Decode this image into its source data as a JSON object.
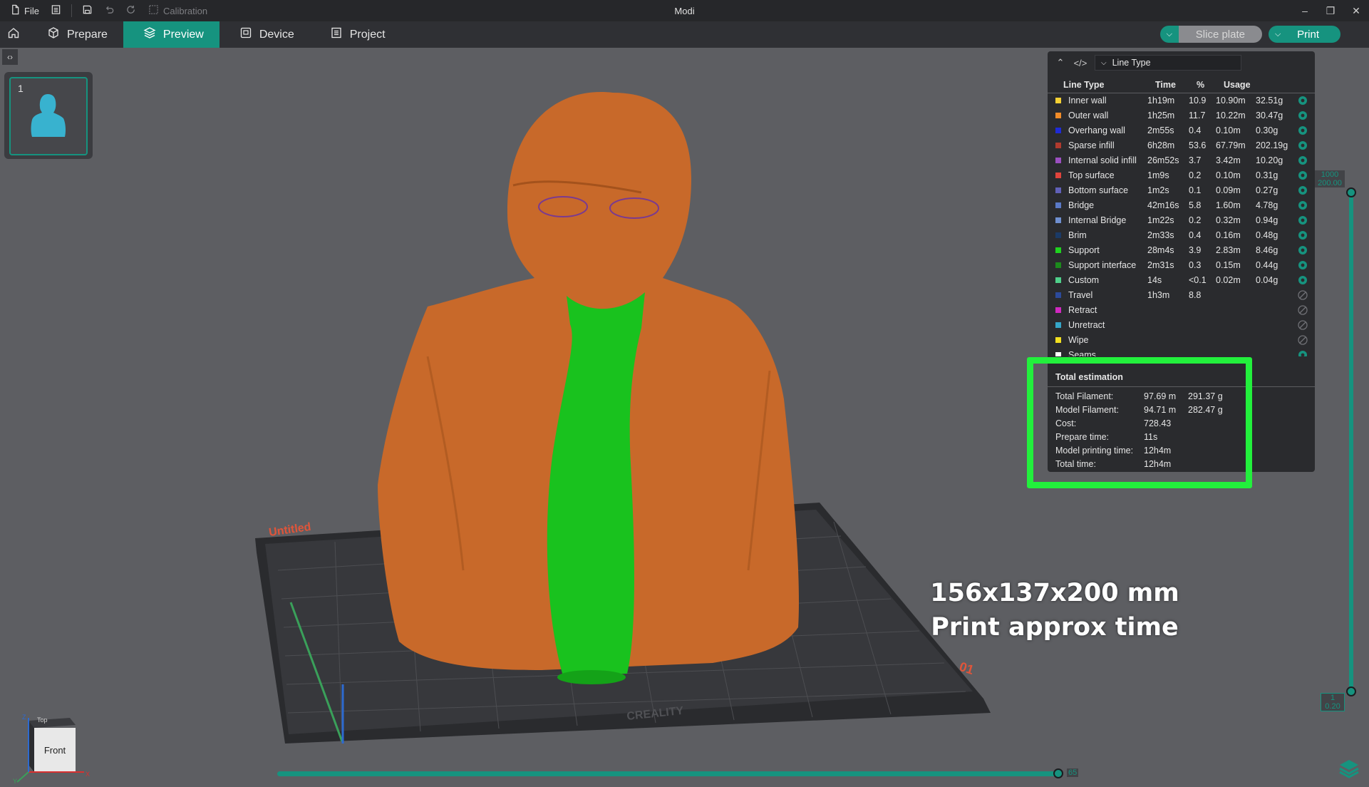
{
  "window": {
    "title": "Modi",
    "file_menu_label": "File",
    "calibration_label": "Calibration"
  },
  "nav": {
    "tabs": [
      {
        "label": "Prepare",
        "icon": "cube-icon"
      },
      {
        "label": "Preview",
        "icon": "layers-icon",
        "active": true
      },
      {
        "label": "Device",
        "icon": "device-icon"
      },
      {
        "label": "Project",
        "icon": "project-icon"
      }
    ],
    "slice_plate_label": "Slice plate",
    "print_label": "Print"
  },
  "plate": {
    "number": "1"
  },
  "legend": {
    "view_type": "Line Type",
    "columns": [
      "Line Type",
      "Time",
      "%",
      "Usage"
    ],
    "rows": [
      {
        "name": "Inner wall",
        "time": "1h19m",
        "pct": "10.9",
        "length": "10.90m",
        "weight": "32.51g",
        "color": "#f4d034",
        "visible": true
      },
      {
        "name": "Outer wall",
        "time": "1h25m",
        "pct": "11.7",
        "length": "10.22m",
        "weight": "30.47g",
        "color": "#f28c28",
        "visible": true
      },
      {
        "name": "Overhang wall",
        "time": "2m55s",
        "pct": "0.4",
        "length": "0.10m",
        "weight": "0.30g",
        "color": "#1f2bd6",
        "visible": true
      },
      {
        "name": "Sparse infill",
        "time": "6h28m",
        "pct": "53.6",
        "length": "67.79m",
        "weight": "202.19g",
        "color": "#b03a2e",
        "visible": true
      },
      {
        "name": "Internal solid infill",
        "time": "26m52s",
        "pct": "3.7",
        "length": "3.42m",
        "weight": "10.20g",
        "color": "#9b4fc0",
        "visible": true
      },
      {
        "name": "Top surface",
        "time": "1m9s",
        "pct": "0.2",
        "length": "0.10m",
        "weight": "0.31g",
        "color": "#e0443c",
        "visible": true
      },
      {
        "name": "Bottom surface",
        "time": "1m2s",
        "pct": "0.1",
        "length": "0.09m",
        "weight": "0.27g",
        "color": "#6060b8",
        "visible": true
      },
      {
        "name": "Bridge",
        "time": "42m16s",
        "pct": "5.8",
        "length": "1.60m",
        "weight": "4.78g",
        "color": "#5a79c6",
        "visible": true
      },
      {
        "name": "Internal Bridge",
        "time": "1m22s",
        "pct": "0.2",
        "length": "0.32m",
        "weight": "0.94g",
        "color": "#6f8fd0",
        "visible": true
      },
      {
        "name": "Brim",
        "time": "2m33s",
        "pct": "0.4",
        "length": "0.16m",
        "weight": "0.48g",
        "color": "#1b3a66",
        "visible": true
      },
      {
        "name": "Support",
        "time": "28m4s",
        "pct": "3.9",
        "length": "2.83m",
        "weight": "8.46g",
        "color": "#1fd21f",
        "visible": true
      },
      {
        "name": "Support interface",
        "time": "2m31s",
        "pct": "0.3",
        "length": "0.15m",
        "weight": "0.44g",
        "color": "#1c8a1c",
        "visible": true
      },
      {
        "name": "Custom",
        "time": "14s",
        "pct": "<0.1",
        "length": "0.02m",
        "weight": "0.04g",
        "color": "#4fd08a",
        "visible": true
      },
      {
        "name": "Travel",
        "time": "1h3m",
        "pct": "8.8",
        "length": "",
        "weight": "",
        "color": "#2c4a9a",
        "visible": false
      },
      {
        "name": "Retract",
        "time": "",
        "pct": "",
        "length": "",
        "weight": "",
        "color": "#d028c0",
        "visible": false
      },
      {
        "name": "Unretract",
        "time": "",
        "pct": "",
        "length": "",
        "weight": "",
        "color": "#35a6c8",
        "visible": false
      },
      {
        "name": "Wipe",
        "time": "",
        "pct": "",
        "length": "",
        "weight": "",
        "color": "#f2e020",
        "visible": false
      },
      {
        "name": "Seams",
        "time": "",
        "pct": "",
        "length": "",
        "weight": "",
        "color": "#ffffff",
        "visible": true
      }
    ]
  },
  "estimation": {
    "title": "Total estimation",
    "rows": [
      {
        "label": "Total Filament:",
        "v1": "97.69 m",
        "v2": "291.37 g"
      },
      {
        "label": "Model Filament:",
        "v1": "94.71 m",
        "v2": "282.47 g"
      },
      {
        "label": "Cost:",
        "v1": "728.43",
        "v2": ""
      },
      {
        "label": "Prepare time:",
        "v1": "11s",
        "v2": ""
      },
      {
        "label": "Model printing time:",
        "v1": "12h4m",
        "v2": ""
      },
      {
        "label": "Total time:",
        "v1": "12h4m",
        "v2": ""
      }
    ]
  },
  "annotation": {
    "line1": "156x137x200 mm",
    "line2": "Print approx time"
  },
  "layer_slider": {
    "top_label_1": "1000",
    "top_label_2": "200.00",
    "bottom_label_1": "1",
    "bottom_label_2": "0.20"
  },
  "move_slider": {
    "value_label": "65"
  },
  "view_cube": {
    "face_label": "Front",
    "top_label": "Top"
  },
  "bed": {
    "plate_name": "Untitled",
    "plate_index": "01",
    "brand": "CREALITY"
  },
  "colors": {
    "accent": "#16937f",
    "highlight": "#22f03c",
    "model_orange": "#c8692a",
    "support_green": "#19c21e"
  }
}
